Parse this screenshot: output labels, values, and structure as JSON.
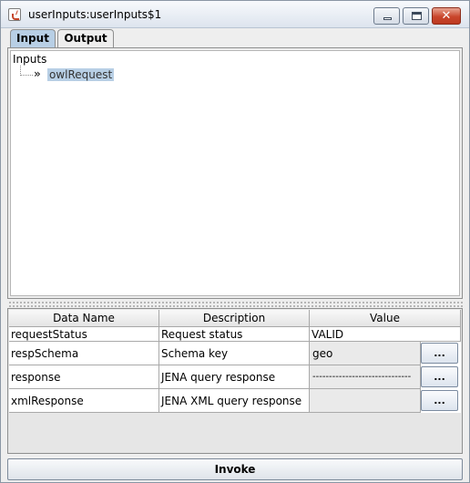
{
  "window": {
    "title": "userInputs:userInputs$1",
    "close_label": "✕"
  },
  "tabs": [
    {
      "label": "Input",
      "selected": true
    },
    {
      "label": "Output",
      "selected": false
    }
  ],
  "tree": {
    "root_label": "Inputs",
    "chevron": "»",
    "children": [
      {
        "label": "owlRequest",
        "selected": true
      }
    ]
  },
  "table": {
    "columns": [
      "Data Name",
      "Description",
      "Value"
    ],
    "rows": [
      {
        "name": "requestStatus",
        "description": "Request status",
        "value": "VALID",
        "has_button": false
      },
      {
        "name": "respSchema",
        "description": "Schema key",
        "value": "geo",
        "has_button": true
      },
      {
        "name": "response",
        "description": "JENA query response",
        "value": "------------------------------",
        "has_button": true
      },
      {
        "name": "xmlResponse",
        "description": "JENA XML query response",
        "value": "",
        "has_button": true
      }
    ],
    "button_label": "..."
  },
  "actions": {
    "invoke_label": "Invoke"
  },
  "colors": {
    "selection": "#b8cfe5",
    "close_button": "#c9462c"
  }
}
